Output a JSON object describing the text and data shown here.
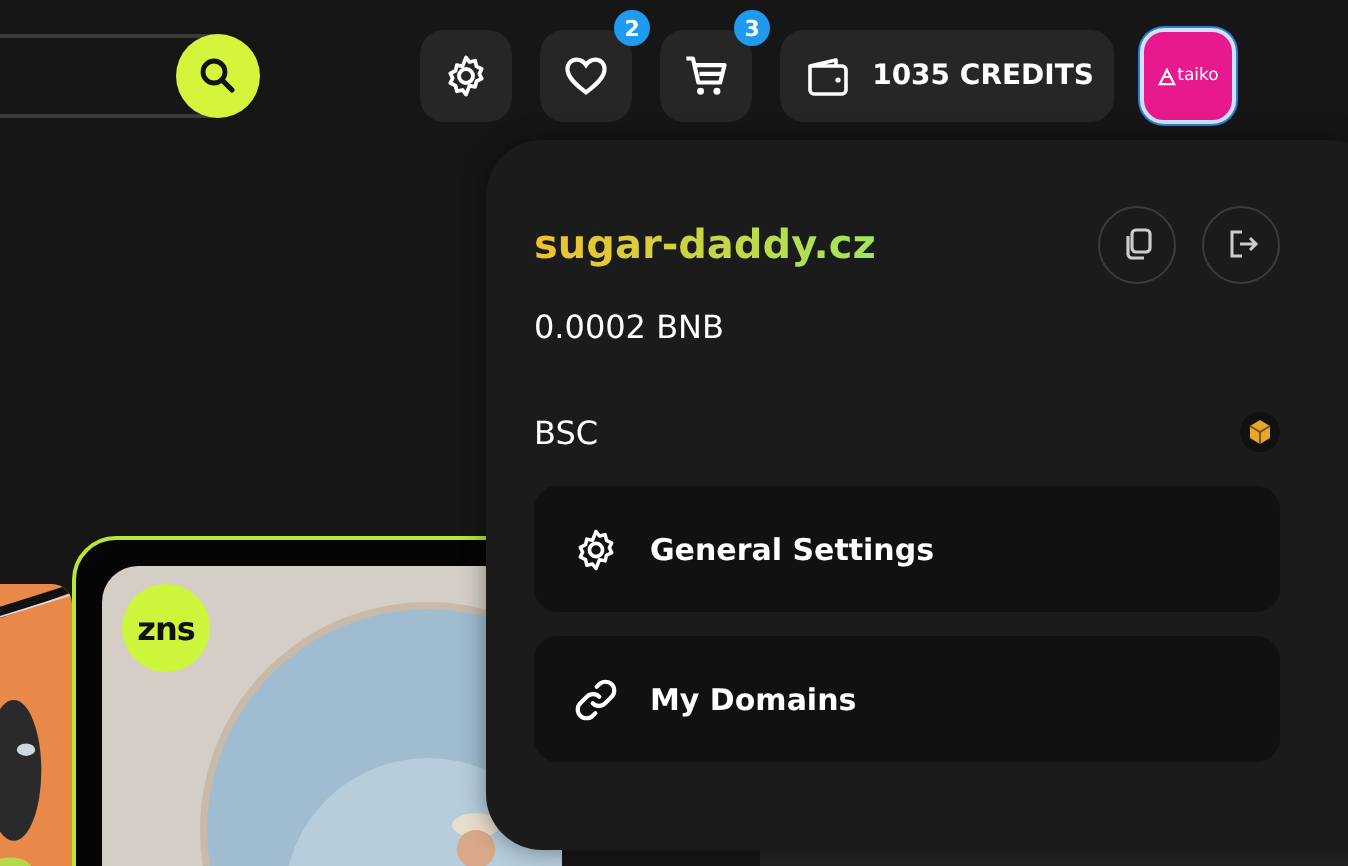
{
  "header": {
    "icon_buttons": [
      {
        "kind": "settings"
      },
      {
        "kind": "favorites",
        "badge": "2"
      },
      {
        "kind": "cart",
        "badge": "3"
      }
    ],
    "credits": "1035 CREDITS",
    "avatar_label": "taiko"
  },
  "gallery": {
    "featured_badge": "zns"
  },
  "account_menu": {
    "domain": "sugar-daddy.cz",
    "balance": "0.0002 BNB",
    "network": "BSC",
    "items": [
      {
        "label": "General Settings",
        "kind": "gear"
      },
      {
        "label": "My Domains",
        "kind": "link"
      }
    ]
  }
}
